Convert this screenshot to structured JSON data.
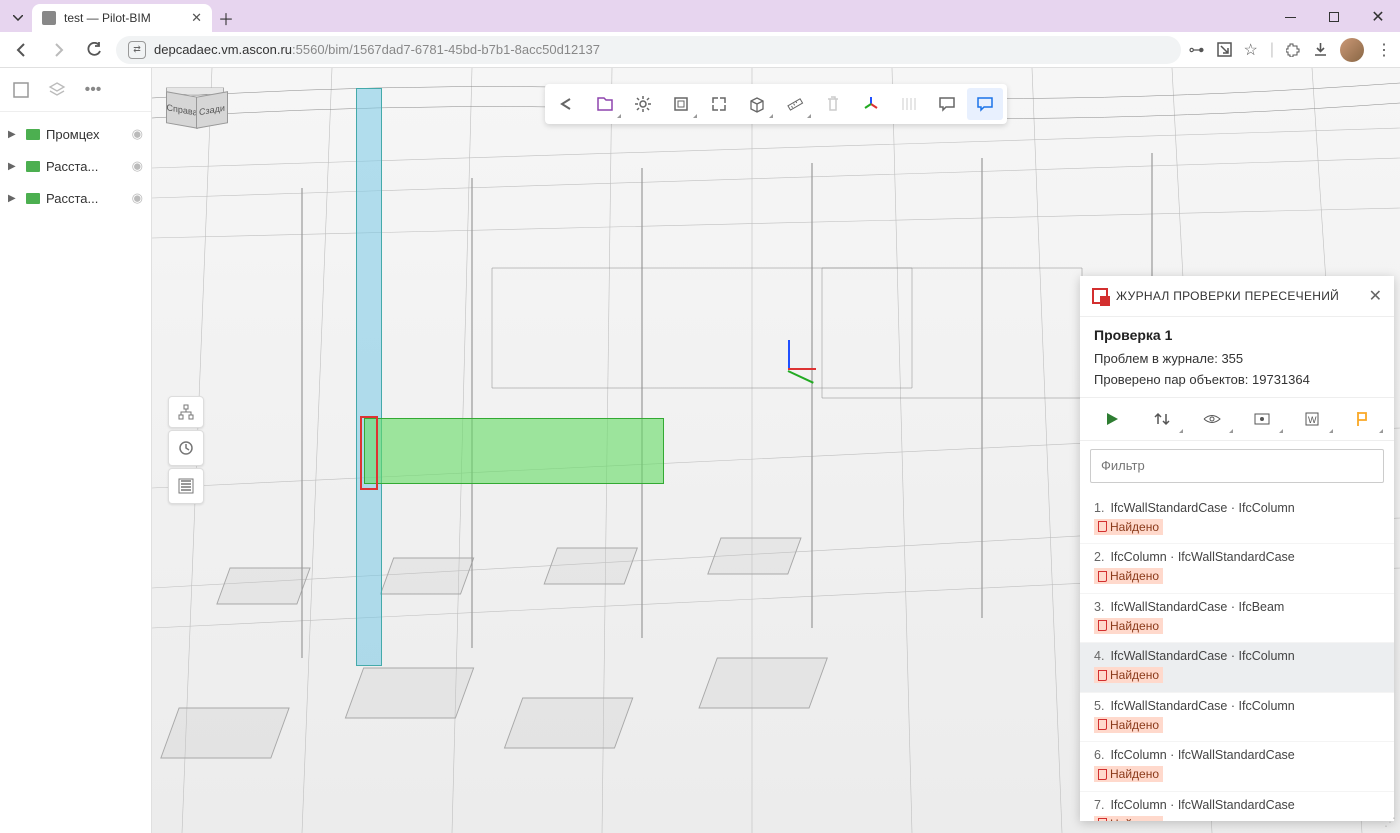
{
  "browser": {
    "tab_title": "test — Pilot-BIM",
    "url_host": "depcadaec.vm.ascon.ru",
    "url_path": ":5560/bim/1567dad7-6781-45bd-b7b1-8acc50d12137"
  },
  "navcube": {
    "right": "Справа",
    "back": "Сзади"
  },
  "sidebar": {
    "items": [
      {
        "label": "Промцех"
      },
      {
        "label": "Расста..."
      },
      {
        "label": "Расста..."
      }
    ]
  },
  "clash": {
    "panel_title": "ЖУРНАЛ ПРОВЕРКИ ПЕРЕСЕЧЕНИЙ",
    "check_title": "Проверка 1",
    "problems_label": "Проблем в журнале: ",
    "problems_count": "355",
    "pairs_label": "Проверено пар объектов: ",
    "pairs_count": "19731364",
    "filter_placeholder": "Фильтр",
    "status_label": "Найдено",
    "items": [
      {
        "n": "1.",
        "a": "IfcWallStandardCase",
        "b": "IfcColumn"
      },
      {
        "n": "2.",
        "a": "IfcColumn",
        "b": "IfcWallStandardCase"
      },
      {
        "n": "3.",
        "a": "IfcWallStandardCase",
        "b": "IfcBeam"
      },
      {
        "n": "4.",
        "a": "IfcWallStandardCase",
        "b": "IfcColumn"
      },
      {
        "n": "5.",
        "a": "IfcWallStandardCase",
        "b": "IfcColumn"
      },
      {
        "n": "6.",
        "a": "IfcColumn",
        "b": "IfcWallStandardCase"
      },
      {
        "n": "7.",
        "a": "IfcColumn",
        "b": "IfcWallStandardCase"
      }
    ]
  }
}
